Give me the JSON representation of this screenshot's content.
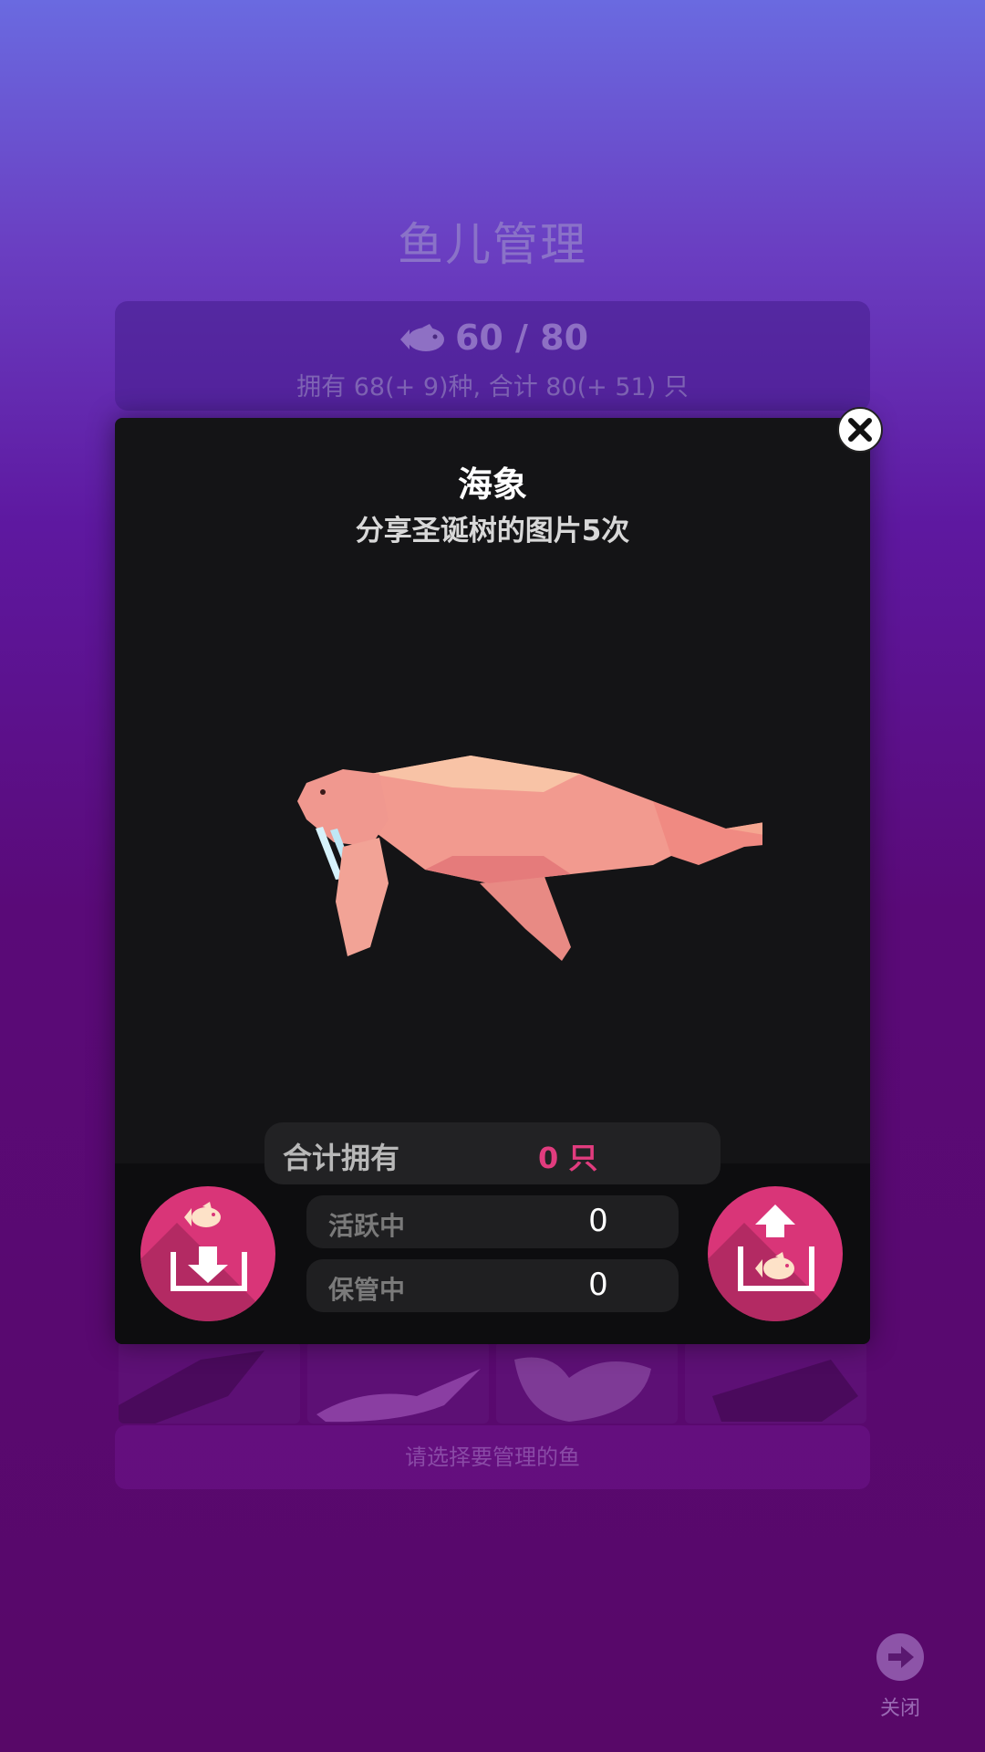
{
  "background": {
    "title": "鱼儿管理",
    "capacity": "60 / 80",
    "summary": "拥有 68(+ 9)种, 合计 80(+ 51) 只",
    "select_hint": "请选择要管理的鱼",
    "close_label": "关闭"
  },
  "modal": {
    "name": "海象",
    "unlock_condition": "分享圣诞树的图片5次",
    "total_label": "合计拥有",
    "total_value": "0 只",
    "active_label": "活跃中",
    "active_value": "0",
    "stored_label": "保管中",
    "stored_value": "0"
  },
  "colors": {
    "accent_pink": "#d93578",
    "total_value_color": "#e13c7e",
    "modal_bg": "#141416"
  },
  "icons": {
    "close": "close-icon",
    "store": "fish-store-icon",
    "release": "fish-release-icon",
    "background_fish": "fish-icon",
    "background_close": "arrow-right-icon"
  }
}
